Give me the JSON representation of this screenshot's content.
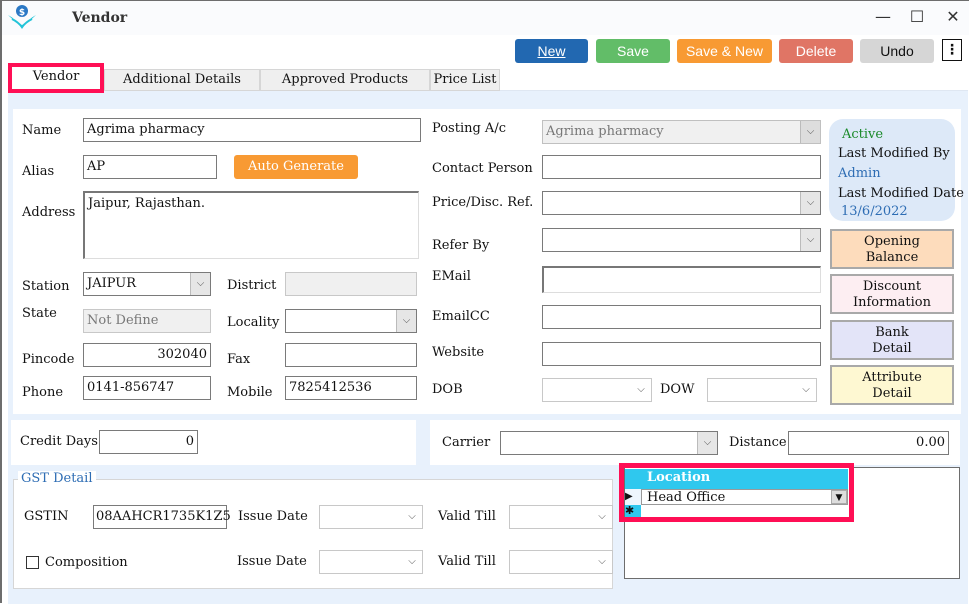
{
  "window": {
    "title": "Vendor",
    "logo_icon": "app-logo-icon",
    "controls": {
      "minimize": "—",
      "maximize": "☐",
      "close": "✕"
    }
  },
  "toolbar": {
    "buttons": [
      {
        "label": "New",
        "color": "#2268b1"
      },
      {
        "label": "Save",
        "color": "#62bd68"
      },
      {
        "label": "Save & New",
        "color": "#f89a33"
      },
      {
        "label": "Delete",
        "color": "#e07565"
      },
      {
        "label": "Undo",
        "color": "#d6d6d6"
      }
    ],
    "more_icon": "⋮"
  },
  "tabs": [
    {
      "label": "Vendor",
      "active": true
    },
    {
      "label": "Additional Details"
    },
    {
      "label": "Approved Products"
    },
    {
      "label": "Price List"
    }
  ],
  "form": {
    "name": {
      "label": "Name",
      "value": "Agrima pharmacy"
    },
    "alias": {
      "label": "Alias",
      "value": "AP"
    },
    "auto_generate": "Auto Generate",
    "address": {
      "label": "Address",
      "value": "Jaipur, Rajasthan."
    },
    "station": {
      "label": "Station",
      "value": "JAIPUR"
    },
    "district": {
      "label": "District",
      "value": ""
    },
    "state": {
      "label": "State",
      "value": "Not Define"
    },
    "locality": {
      "label": "Locality",
      "value": ""
    },
    "pincode": {
      "label": "Pincode",
      "value": "302040"
    },
    "fax": {
      "label": "Fax",
      "value": ""
    },
    "phone": {
      "label": "Phone",
      "value": "0141-856747"
    },
    "mobile": {
      "label": "Mobile",
      "value": "7825412536"
    },
    "posting_ac": {
      "label": "Posting A/c",
      "value": "Agrima pharmacy"
    },
    "contact_person": {
      "label": "Contact Person",
      "value": ""
    },
    "price_disc_ref": {
      "label": "Price/Disc. Ref.",
      "value": ""
    },
    "refer_by": {
      "label": "Refer By",
      "value": ""
    },
    "email": {
      "label": "EMail",
      "value": ""
    },
    "emailcc": {
      "label": "EmailCC",
      "value": ""
    },
    "website": {
      "label": "Website",
      "value": ""
    },
    "dob": {
      "label": "DOB",
      "value": ""
    },
    "dow": {
      "label": "DOW",
      "value": ""
    },
    "credit_days": {
      "label": "Credit Days",
      "value": "0"
    },
    "carrier": {
      "label": "Carrier",
      "value": ""
    },
    "distance": {
      "label": "Distance",
      "value": "0.00"
    }
  },
  "status": {
    "active": "Active",
    "last_modified_by_label": "Last Modified By",
    "last_modified_by": "Admin",
    "last_modified_date_label": "Last Modified Date",
    "last_modified_date": "13/6/2022"
  },
  "side_buttons": [
    {
      "line1": "Opening",
      "line2": "Balance",
      "color": "#fddcbc"
    },
    {
      "line1": "Discount",
      "line2": "Information",
      "color": "#fdeef2"
    },
    {
      "line1": "Bank",
      "line2": "Detail",
      "color": "#e3e4f8"
    },
    {
      "line1": "Attribute",
      "line2": "Detail",
      "color": "#fef8d2"
    }
  ],
  "gst": {
    "legend": "GST Detail",
    "gstin_label": "GSTIN",
    "gstin": "08AAHCR1735K1Z5",
    "issue_date_label": "Issue Date",
    "valid_till_label": "Valid Till",
    "composition_label": "Composition",
    "composition_checked": false
  },
  "location_grid": {
    "header": "Location",
    "rows": [
      "Head Office"
    ],
    "new_row_marker": "✱",
    "current_row_marker": "▶"
  }
}
